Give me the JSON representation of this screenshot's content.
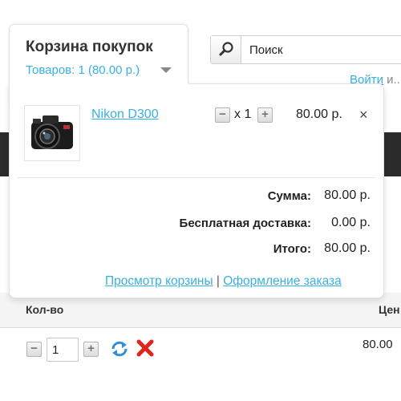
{
  "header": {
    "search": {
      "value": "Поиск"
    },
    "login_link": "Войти",
    "login_suffix": "и..."
  },
  "cart": {
    "title": "Корзина покупок",
    "count_text": "Товаров: 1 (80.00 р.)",
    "item": {
      "name": "Nikon D300",
      "qty_text": "x 1",
      "price": "80.00 р.",
      "remove_glyph": "×",
      "image_icon": "camera-icon"
    },
    "totals": [
      {
        "label": "Сумма:",
        "value": "80.00 р."
      },
      {
        "label": "Бесплатная доставка:",
        "value": "0.00 р."
      },
      {
        "label": "Итого:",
        "value": "80.00 р."
      }
    ],
    "view_cart_link": "Просмотр корзины",
    "link_separator": "|",
    "checkout_link": "Оформление заказа"
  },
  "table": {
    "qty_header": "Кол-во",
    "price_header": "Цен",
    "row": {
      "qty_value": "1",
      "price": "80.00"
    }
  },
  "colors": {
    "link": "#38b0e3",
    "dark_bar": "#2b2b2b",
    "delete_red": "#e0261c",
    "refresh_blue": "#2f8fd8"
  }
}
